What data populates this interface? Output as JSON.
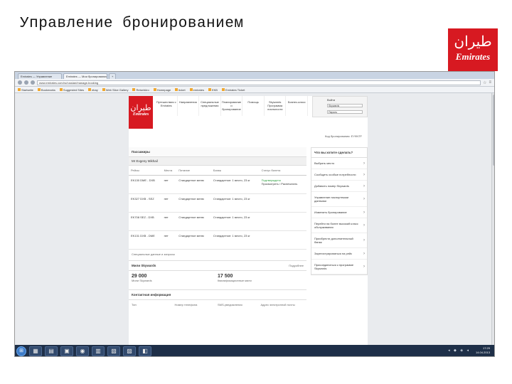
{
  "slide": {
    "title": "Управление бронированием",
    "logo_text": "Emirates",
    "logo_glyph": "ﻃﻴﺮﺍﻥ"
  },
  "browser": {
    "tabs": [
      {
        "label": "Emirates — Управление"
      },
      {
        "label": "Emirates — Мои бронирования"
      },
      {
        "label": "+"
      }
    ],
    "url": "www.emirates.com/ru/russian/manage-booking",
    "bookmarks": [
      "Startseite",
      "Bookmarks",
      "Suggested Sites",
      "ebay",
      "Web Slice Gallery",
      "Reisebüro",
      "Homepage",
      "ticket",
      "emirates",
      "EKB",
      "Emirates Ticket"
    ]
  },
  "site": {
    "logo_text": "Emirates",
    "logo_glyph": "ﻃﻴﺮﺍﻥ",
    "nav": [
      "Путешествия с Emirates",
      "Направления",
      "Специальные предложения",
      "Планирование и бронирование",
      "Помощь",
      "Skywards Программа лояльности",
      "Бизнес-класс"
    ],
    "login": {
      "label": "Войти",
      "field1": "Skywards",
      "field2": "Пароль"
    },
    "booking_ref": "Код бронирования: EY9NTF"
  },
  "passengers": {
    "title": "Пассажиры",
    "name": "Mr Evgeny Mikhail",
    "columns": [
      "Рейсы",
      "Места",
      "Питание",
      "Багаж",
      "Статус билета"
    ],
    "rows": [
      {
        "flight": "EK130 DME - DXB",
        "seat": "нет",
        "meal": "Стандартное меню",
        "baggage": "Стандартное: 1 место, 23 кг",
        "status": "Подтверждено",
        "status2": "Просмотреть / Распечатать"
      },
      {
        "flight": "EK327 DXB - SEZ",
        "seat": "нет",
        "meal": "Стандартное меню",
        "baggage": "Стандартное: 1 место, 23 кг",
        "status": "",
        "status2": ""
      },
      {
        "flight": "EK708 SEZ - DXB",
        "seat": "нет",
        "meal": "Стандартное меню",
        "baggage": "Стандартное: 1 место, 23 кг",
        "status": "",
        "status2": ""
      },
      {
        "flight": "EK131 DXB - DME",
        "seat": "нет",
        "meal": "Стандартное меню",
        "baggage": "Стандартное: 1 место, 23 кг",
        "status": "",
        "status2": ""
      }
    ],
    "notes": "Специальные данные и запросы"
  },
  "miles": {
    "title": "Мили Skywards",
    "more": "Подробнее",
    "items": [
      {
        "value": "29 000",
        "caption": "Мили Skywards"
      },
      {
        "value": "17 500",
        "caption": "Квалификационные мили"
      }
    ]
  },
  "contacts": {
    "title": "Контактная информация",
    "columns": [
      "Тип",
      "Номер телефона",
      "SMS-уведомления",
      "Адрес электронной почты"
    ]
  },
  "sidebar": {
    "title": "Что вы хотите сделать?",
    "items": [
      "Выбрать место",
      "Сообщить особые потребности",
      "Добавить номер Skywards",
      "Управление паспортными данными",
      "Изменить бронирование",
      "Перейти на более высокий класс обслуживания",
      "Приобрести дополнительный багаж",
      "Зарегистрироваться на рейс",
      "Присоединиться к программе Skywards"
    ]
  },
  "taskbar": {
    "start": "⊞",
    "apps": [
      "▦",
      "▤",
      "▣",
      "◉",
      "▥",
      "▧",
      "▨",
      "◧"
    ],
    "tray_icons": "◂ ◆ ◈ ◂",
    "time": "17:29",
    "date": "14.04.2013"
  }
}
